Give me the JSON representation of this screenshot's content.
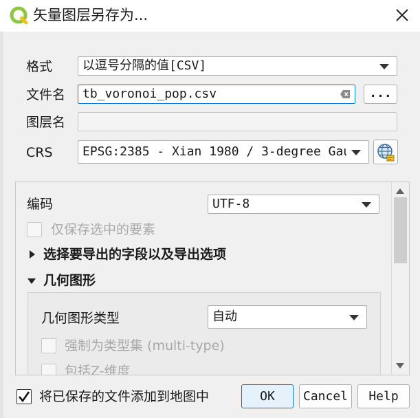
{
  "window": {
    "title": "矢量图层另存为...",
    "app_icon": "qgis-logo-icon",
    "close_icon": "close-icon"
  },
  "form": {
    "format_label": "格式",
    "format_value": "以逗号分隔的值[CSV]",
    "filename_label": "文件名",
    "filename_value": "tb_voronoi_pop.csv",
    "browse_label": "...",
    "layername_label": "图层名",
    "layername_value": "",
    "crs_label": "CRS",
    "crs_value": "EPSG:2385 - Xian 1980 / 3-degree Gau",
    "crs_icon": "globe-projection-icon"
  },
  "options": {
    "encoding_label": "编码",
    "encoding_value": "UTF-8",
    "save_selected_label": "仅保存选中的要素",
    "save_selected_checked": false,
    "fields_section_label": "选择要导出的字段以及导出选项",
    "fields_section_expanded": false,
    "geometry_section_label": "几何图形",
    "geometry_section_expanded": true,
    "geometry_type_label": "几何图形类型",
    "geometry_type_value": "自动",
    "force_multi_label": "强制为类型集 (multi-type)",
    "include_z_label": "包括Z-维度"
  },
  "footer": {
    "add_to_map_label": "将已保存的文件添加到地图中",
    "add_to_map_checked": true,
    "ok_label": "OK",
    "cancel_label": "Cancel",
    "help_label": "Help"
  }
}
